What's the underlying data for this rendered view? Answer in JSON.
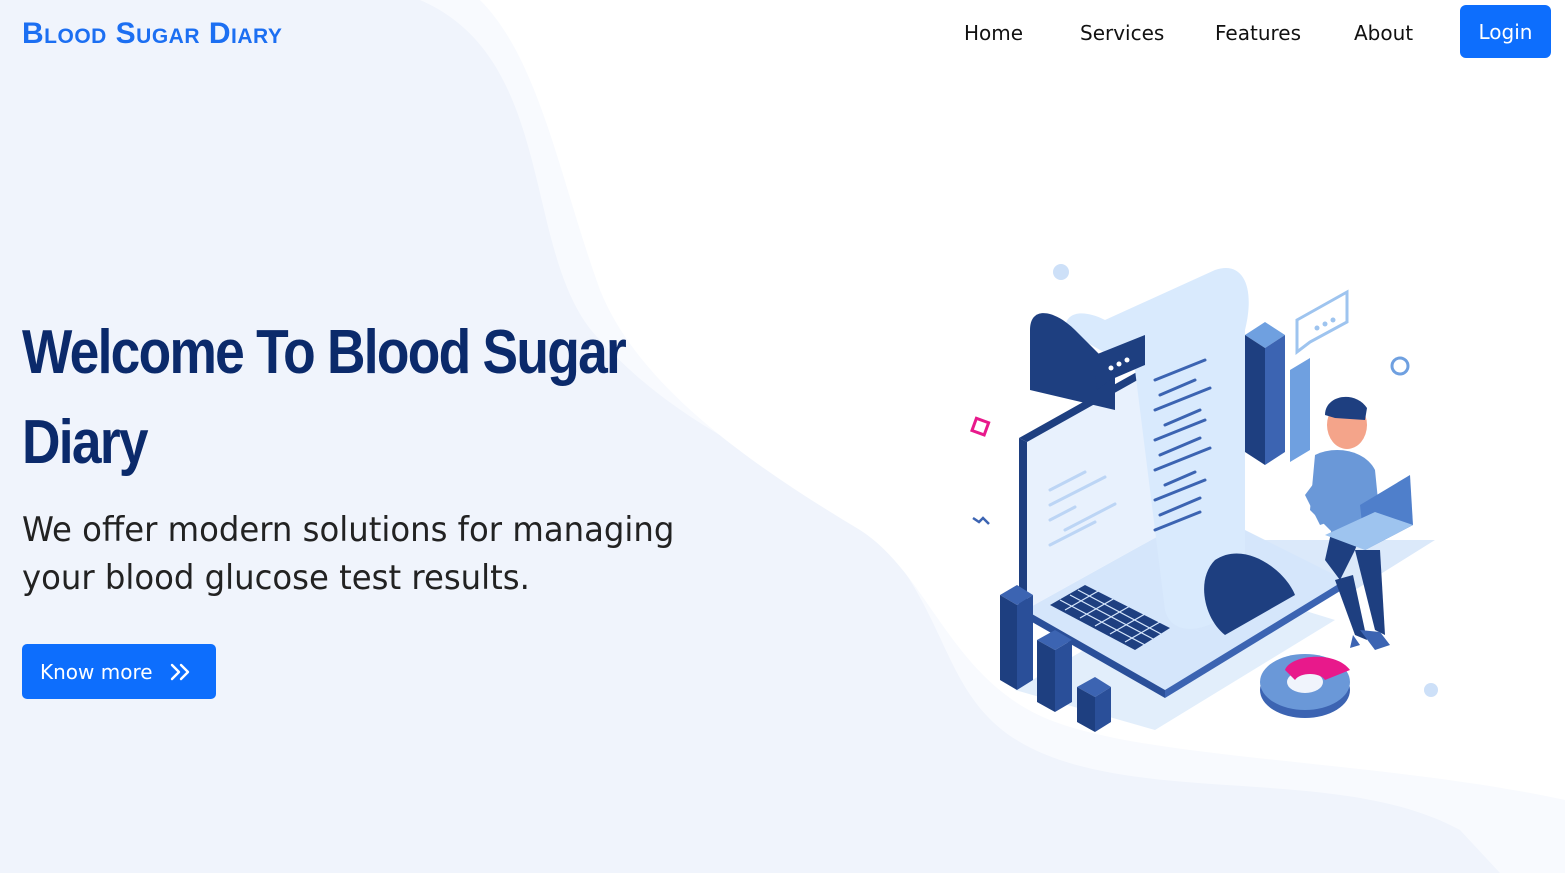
{
  "navbar": {
    "brand": "Blood Sugar Diary",
    "links": [
      "Home",
      "Services",
      "Features",
      "About"
    ],
    "login_label": "Login"
  },
  "hero": {
    "title": "Welcome To Blood Sugar Diary",
    "subtitle": "We offer modern solutions for managing your blood glucose test results.",
    "cta_label": "Know more",
    "cta_icon": "double-chevron-right-icon"
  },
  "illustration": {
    "name": "isometric-person-with-laptop-and-document-illustration"
  },
  "colors": {
    "brand": "#1c6ff2",
    "primary_button": "#0d6efd",
    "heading": "#0b2a6b",
    "background": "#f0f4fc",
    "illustration_dark": "#1e3f80",
    "illustration_light": "#d6e7fb",
    "accent_pink": "#e8198b"
  }
}
